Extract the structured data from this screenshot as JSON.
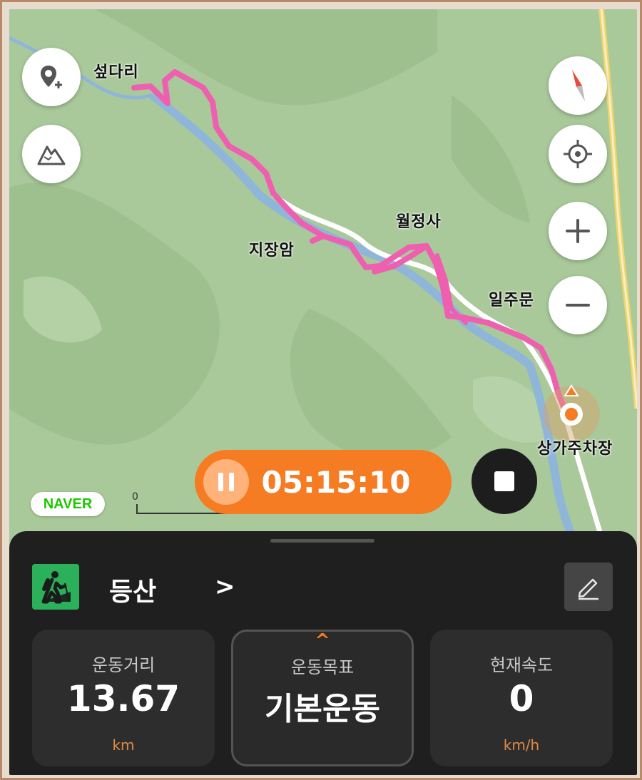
{
  "map": {
    "places": [
      {
        "id": "seopdari",
        "label": "섶다리"
      },
      {
        "id": "jijangam",
        "label": "지장암"
      },
      {
        "id": "woljeongsa",
        "label": "월정사"
      },
      {
        "id": "iljumun",
        "label": "일주문"
      },
      {
        "id": "sangga",
        "label": "상가주차장"
      }
    ],
    "brand_label": "NAVER",
    "scale_label": "0",
    "route_color": "#ef5fb0"
  },
  "controls": {
    "timer": "05:15:10"
  },
  "panel": {
    "activity_title": "등산",
    "chevron": ">",
    "stats": [
      {
        "label": "운동거리",
        "value": "13.67",
        "unit": "km"
      },
      {
        "label": "운동목표",
        "value": "기본운동",
        "caret": "^"
      },
      {
        "label": "현재속도",
        "value": "0",
        "unit": "km/h"
      }
    ]
  },
  "colors": {
    "accent": "#f57c22",
    "panel_bg": "#1f1f1f",
    "activity_icon_bg": "#2bb15a"
  }
}
